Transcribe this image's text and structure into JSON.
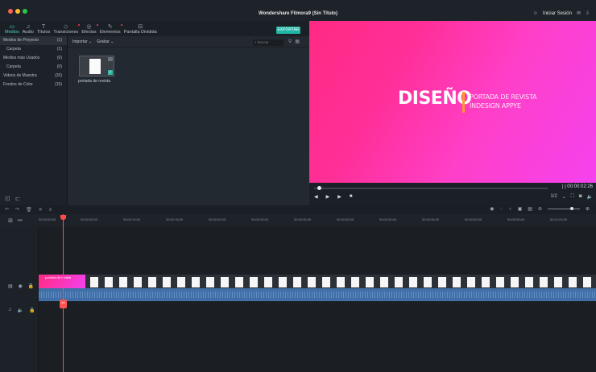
{
  "window": {
    "title": "Wondershare Filmora9 (Sin Título)",
    "login": "Iniciar Sesión"
  },
  "toolbar": {
    "tabs": [
      {
        "label": "Medios",
        "icon": "folder-icon"
      },
      {
        "label": "Audio",
        "icon": "music-note-icon"
      },
      {
        "label": "Títulos",
        "icon": "text-icon"
      },
      {
        "label": "Transiciones",
        "icon": "transition-icon"
      },
      {
        "label": "Efectos",
        "icon": "effects-icon"
      },
      {
        "label": "Elementos",
        "icon": "elements-icon"
      },
      {
        "label": "Pantalla Dividida",
        "icon": "split-screen-icon"
      }
    ],
    "export_label": "EXPORTAR"
  },
  "media_tree": {
    "items": [
      {
        "label": "Medios de Proyecto",
        "count": "(1)"
      },
      {
        "label": "Carpeta",
        "count": "(1)"
      },
      {
        "label": "Medios más Usados",
        "count": "(0)"
      },
      {
        "label": "Carpeta",
        "count": "(0)"
      },
      {
        "label": "Videos de Muestra",
        "count": "(20)"
      },
      {
        "label": "Fondos de Color",
        "count": "(15)"
      }
    ]
  },
  "media_area": {
    "import_label": "Importar",
    "record_label": "Grabar",
    "search_placeholder": "Buscar",
    "thumb_label": "portada de revista"
  },
  "preview": {
    "title": "DISEÑO",
    "subtitle_line1": "PORTADA DE REVISTA",
    "subtitle_line2": "INDESIGN APPYE",
    "timecode": "00:00:02:26",
    "ratio": "1/2"
  },
  "timeline": {
    "ticks": [
      "00:00:00:00",
      "00:00:05:00",
      "00:00:10:00",
      "00:00:15:00",
      "00:00:20:00",
      "00:00:25:00",
      "00:00:30:00",
      "00:00:35:00",
      "00:00:40:00",
      "00:00:45:00",
      "00:00:50:00",
      "00:00:55:00",
      "00:01:00:00"
    ],
    "clip_label": "portada de revista"
  },
  "colors": {
    "accent": "#1fb6a6",
    "playhead": "#ff4a4a",
    "audio": "#3f6fa6",
    "preview_start": "#ff2a83",
    "preview_end": "#f542ee"
  }
}
